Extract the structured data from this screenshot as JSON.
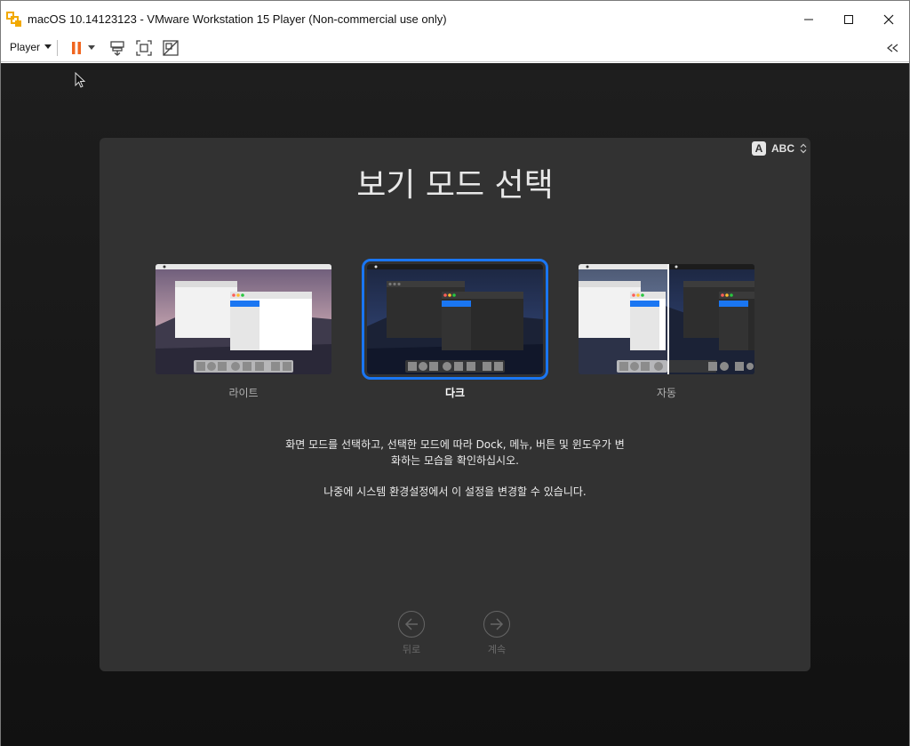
{
  "window": {
    "title": "macOS 10.14123123 - VMware Workstation 15 Player (Non-commercial use only)"
  },
  "toolbar": {
    "player_label": "Player"
  },
  "setup": {
    "input_source": "ABC",
    "input_badge": "A",
    "title": "보기 모드 선택",
    "modes": [
      {
        "label": "라이트",
        "selected": false
      },
      {
        "label": "다크",
        "selected": true
      },
      {
        "label": "자동",
        "selected": false
      }
    ],
    "description_line1": "화면 모드를 선택하고, 선택한 모드에 따라 Dock, 메뉴, 버튼 및 윈도우가 변",
    "description_line2": "화하는 모습을 확인하십시오.",
    "note": "나중에 시스템 환경설정에서 이 설정을 변경할 수 있습니다.",
    "back_label": "뒤로",
    "continue_label": "계속"
  },
  "colors": {
    "accent": "#1a76f2",
    "panel": "#323232",
    "pause_orange": "#f0651f"
  }
}
